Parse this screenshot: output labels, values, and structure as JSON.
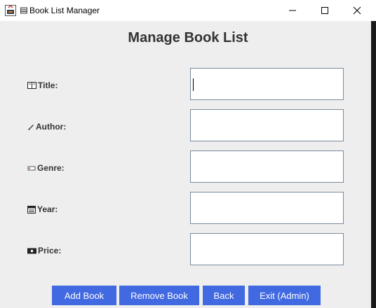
{
  "window": {
    "title": "Book List Manager",
    "controls": [
      "minimize-icon",
      "maximize-icon",
      "close-icon"
    ]
  },
  "page": {
    "heading": "Manage Book List"
  },
  "form": {
    "fields": [
      {
        "label": "Title:",
        "icon": "book-icon",
        "value": "",
        "focused": true
      },
      {
        "label": "Author:",
        "icon": "pen-icon",
        "value": ""
      },
      {
        "label": "Genre:",
        "icon": "tag-icon",
        "value": ""
      },
      {
        "label": "Year:",
        "icon": "calendar-icon",
        "value": ""
      },
      {
        "label": "Price:",
        "icon": "money-icon",
        "value": ""
      }
    ]
  },
  "buttons": {
    "add": "Add Book",
    "remove": "Remove Book",
    "back": "Back",
    "exit": "Exit (Admin)"
  },
  "colors": {
    "button_bg": "#4169e1",
    "button_text": "#ffffff",
    "panel_bg": "#eeeeee",
    "field_border": "#7a8a9c"
  }
}
